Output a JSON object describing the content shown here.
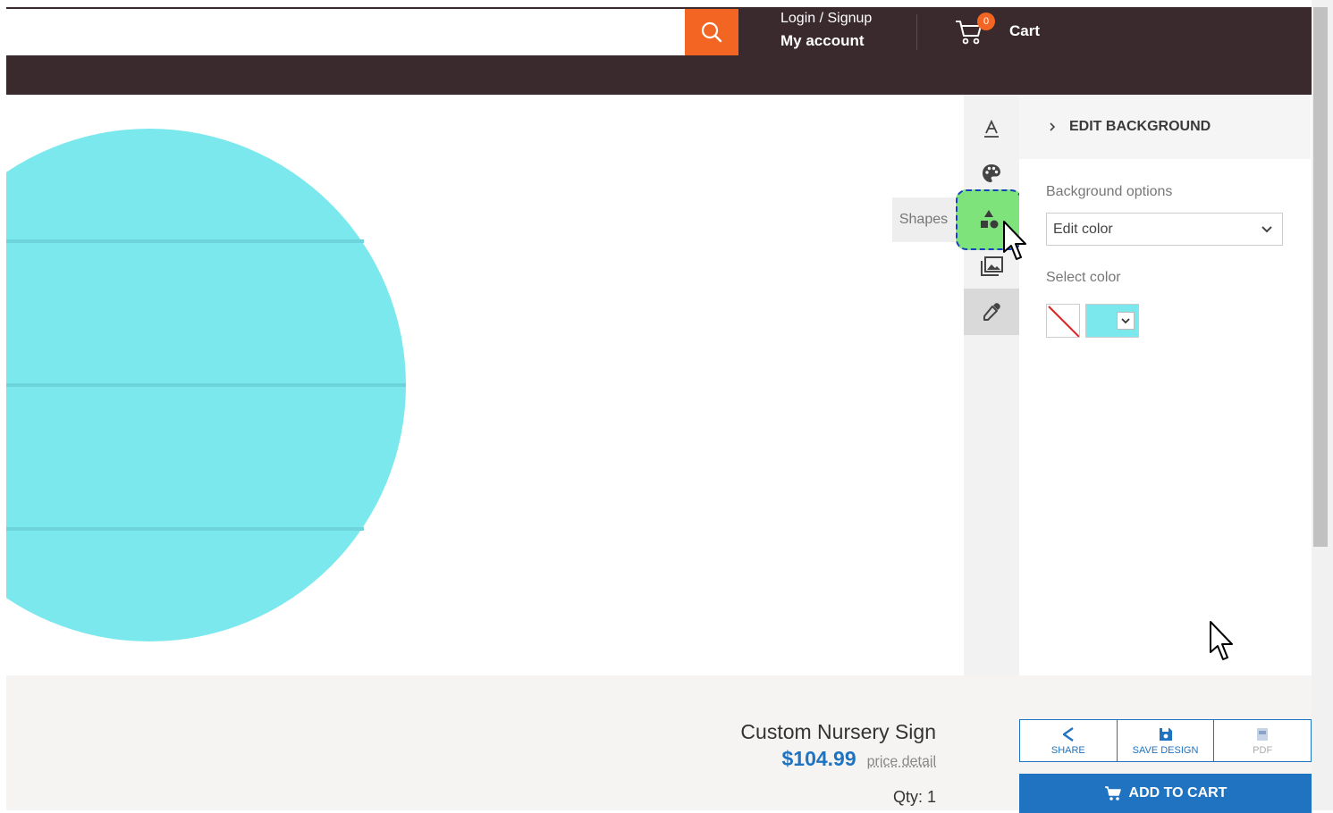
{
  "header": {
    "search": {
      "value": "",
      "placeholder": ""
    },
    "login_label": "Login / Signup",
    "account_label": "My account",
    "cart_label": "Cart",
    "cart_count": "0"
  },
  "toolbar": {
    "tools": [
      "text-icon",
      "palette-icon",
      "shapes-icon",
      "image-icon",
      "eyedropper-icon"
    ],
    "active_tool": "eyedropper-icon",
    "hovered_tool": "shapes-icon",
    "tooltip": "Shapes"
  },
  "panel": {
    "title": "EDIT BACKGROUND",
    "background_options_label": "Background options",
    "background_options_value": "Edit color",
    "select_color_label": "Select color",
    "selected_color": "#7be8ee"
  },
  "product": {
    "name": "Custom Nursery Sign",
    "price": "$104.99",
    "price_detail": "price detail",
    "qty": "Qty: 1"
  },
  "actions": {
    "share": "SHARE",
    "save_design": "SAVE DESIGN",
    "pdf": "PDF",
    "add_to_cart": "ADD TO CART"
  },
  "colors": {
    "header_bg": "#3a2a2e",
    "accent_orange": "#f26522",
    "accent_blue": "#1f73c0",
    "shape_cyan": "#7be8ee",
    "highlight_green": "#7de37a"
  }
}
